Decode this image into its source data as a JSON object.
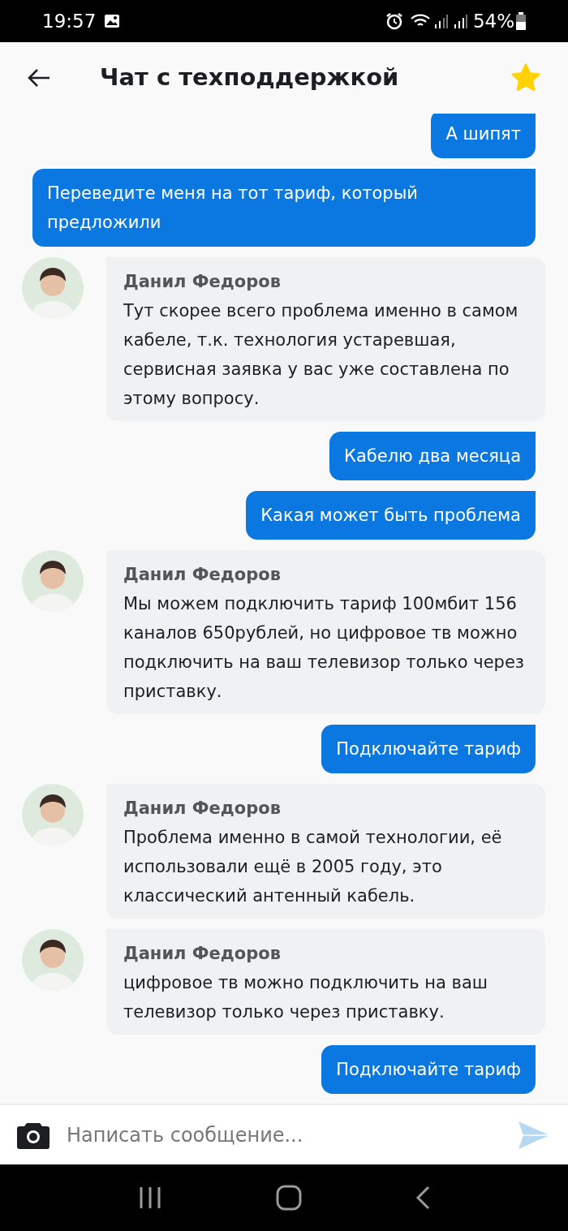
{
  "status_bar": {
    "time": "19:57",
    "battery": "54%"
  },
  "header": {
    "title": "Чат с техподдержкой",
    "favorite": true
  },
  "messages": [
    {
      "kind": "outgoing",
      "text": "А шипят"
    },
    {
      "kind": "outgoing",
      "text": "Переведите меня на тот тариф, который предложили"
    },
    {
      "kind": "incoming",
      "author": "Данил Федоров",
      "text": "Тут скорее всего проблема именно в самом кабеле, т.к. технология устаревшая, сервисная заявка у вас уже составлена по этому вопросу."
    },
    {
      "kind": "outgoing",
      "text": "Кабелю два месяца"
    },
    {
      "kind": "outgoing",
      "text": "Какая может быть проблема"
    },
    {
      "kind": "incoming",
      "author": "Данил Федоров",
      "text": "Мы можем подключить тариф 100мбит 156 каналов 650рублей, но цифровое тв можно подключить на ваш телевизор только через приставку."
    },
    {
      "kind": "outgoing",
      "text": "Подключайте тариф"
    },
    {
      "kind": "incoming",
      "author": "Данил Федоров",
      "text": "Проблема именно в самой технологии, её использовали ещё в 2005 году, это классический антенный кабель."
    },
    {
      "kind": "incoming",
      "author": "Данил Федоров",
      "text": "цифровое тв можно подключить на ваш телевизор только через приставку."
    },
    {
      "kind": "outgoing",
      "text": "Подключайте тариф"
    }
  ],
  "composer": {
    "placeholder": "Написать сообщение..."
  }
}
